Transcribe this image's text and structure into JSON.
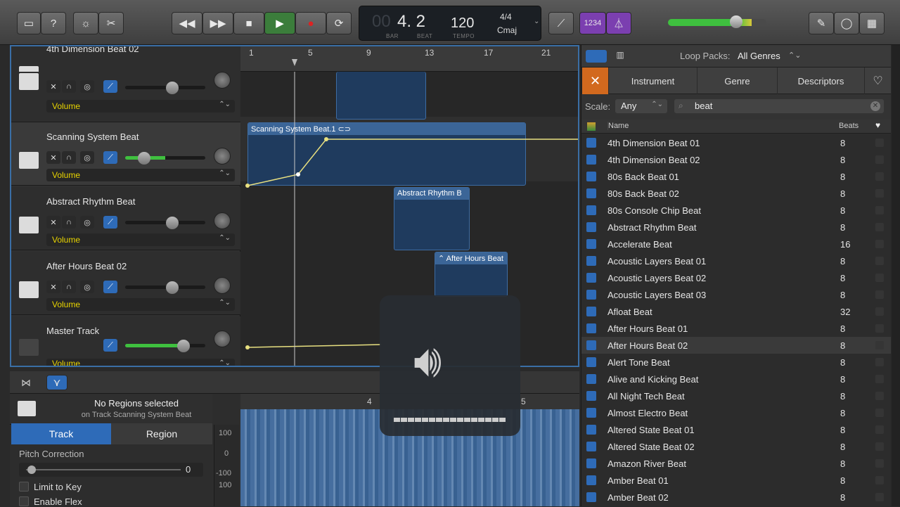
{
  "toolbar": {
    "lcd": {
      "bar_prefix": "00",
      "position": "4. 2",
      "bar_label": "BAR",
      "beat_label": "BEAT",
      "tempo": "120",
      "tempo_label": "TEMPO",
      "time_sig": "4/4",
      "key": "Cmaj"
    },
    "count_in": "1234"
  },
  "ruler": {
    "marks": [
      "1",
      "5",
      "9",
      "13",
      "17",
      "21"
    ]
  },
  "tracks": [
    {
      "name": "4th Dimension Beat 02",
      "automation": "Volume"
    },
    {
      "name": "Scanning System Beat",
      "automation": "Volume"
    },
    {
      "name": "Abstract Rhythm Beat",
      "automation": "Volume"
    },
    {
      "name": "After Hours Beat 02",
      "automation": "Volume"
    },
    {
      "name": "Master Track",
      "automation": "Volume"
    }
  ],
  "regions": {
    "r1": "Scanning System Beat.1",
    "r2": "Abstract Rhythm B",
    "r3": "After Hours Beat"
  },
  "editor": {
    "no_regions": "No Regions selected",
    "on_track": "on Track Scanning System Beat",
    "tab_track": "Track",
    "tab_region": "Region",
    "pitch_label": "Pitch Correction",
    "pitch_value": "0",
    "limit_key": "Limit to Key",
    "enable_flex": "Enable Flex",
    "ruler_a": "4",
    "ruler_b": "5",
    "scale": [
      "100",
      "0",
      "-100",
      "100"
    ]
  },
  "browser": {
    "loop_packs_label": "Loop Packs:",
    "loop_packs_value": "All Genres",
    "tabs": [
      "Instrument",
      "Genre",
      "Descriptors"
    ],
    "scale_label": "Scale:",
    "scale_value": "Any",
    "search_value": "beat",
    "col_name": "Name",
    "col_beats": "Beats",
    "rows": [
      {
        "name": "4th Dimension Beat 01",
        "beats": "8"
      },
      {
        "name": "4th Dimension Beat 02",
        "beats": "8"
      },
      {
        "name": "80s Back Beat 01",
        "beats": "8"
      },
      {
        "name": "80s Back Beat 02",
        "beats": "8"
      },
      {
        "name": "80s Console Chip Beat",
        "beats": "8"
      },
      {
        "name": "Abstract Rhythm Beat",
        "beats": "8"
      },
      {
        "name": "Accelerate Beat",
        "beats": "16"
      },
      {
        "name": "Acoustic Layers Beat 01",
        "beats": "8"
      },
      {
        "name": "Acoustic Layers Beat 02",
        "beats": "8"
      },
      {
        "name": "Acoustic Layers Beat 03",
        "beats": "8"
      },
      {
        "name": "Afloat Beat",
        "beats": "32"
      },
      {
        "name": "After Hours Beat 01",
        "beats": "8"
      },
      {
        "name": "After Hours Beat 02",
        "beats": "8"
      },
      {
        "name": "Alert Tone Beat",
        "beats": "8"
      },
      {
        "name": "Alive and Kicking Beat",
        "beats": "8"
      },
      {
        "name": "All Night Tech Beat",
        "beats": "8"
      },
      {
        "name": "Almost Electro Beat",
        "beats": "8"
      },
      {
        "name": "Altered State Beat 01",
        "beats": "8"
      },
      {
        "name": "Altered State Beat 02",
        "beats": "8"
      },
      {
        "name": "Amazon River Beat",
        "beats": "8"
      },
      {
        "name": "Amber Beat 01",
        "beats": "8"
      },
      {
        "name": "Amber Beat 02",
        "beats": "8"
      }
    ]
  }
}
